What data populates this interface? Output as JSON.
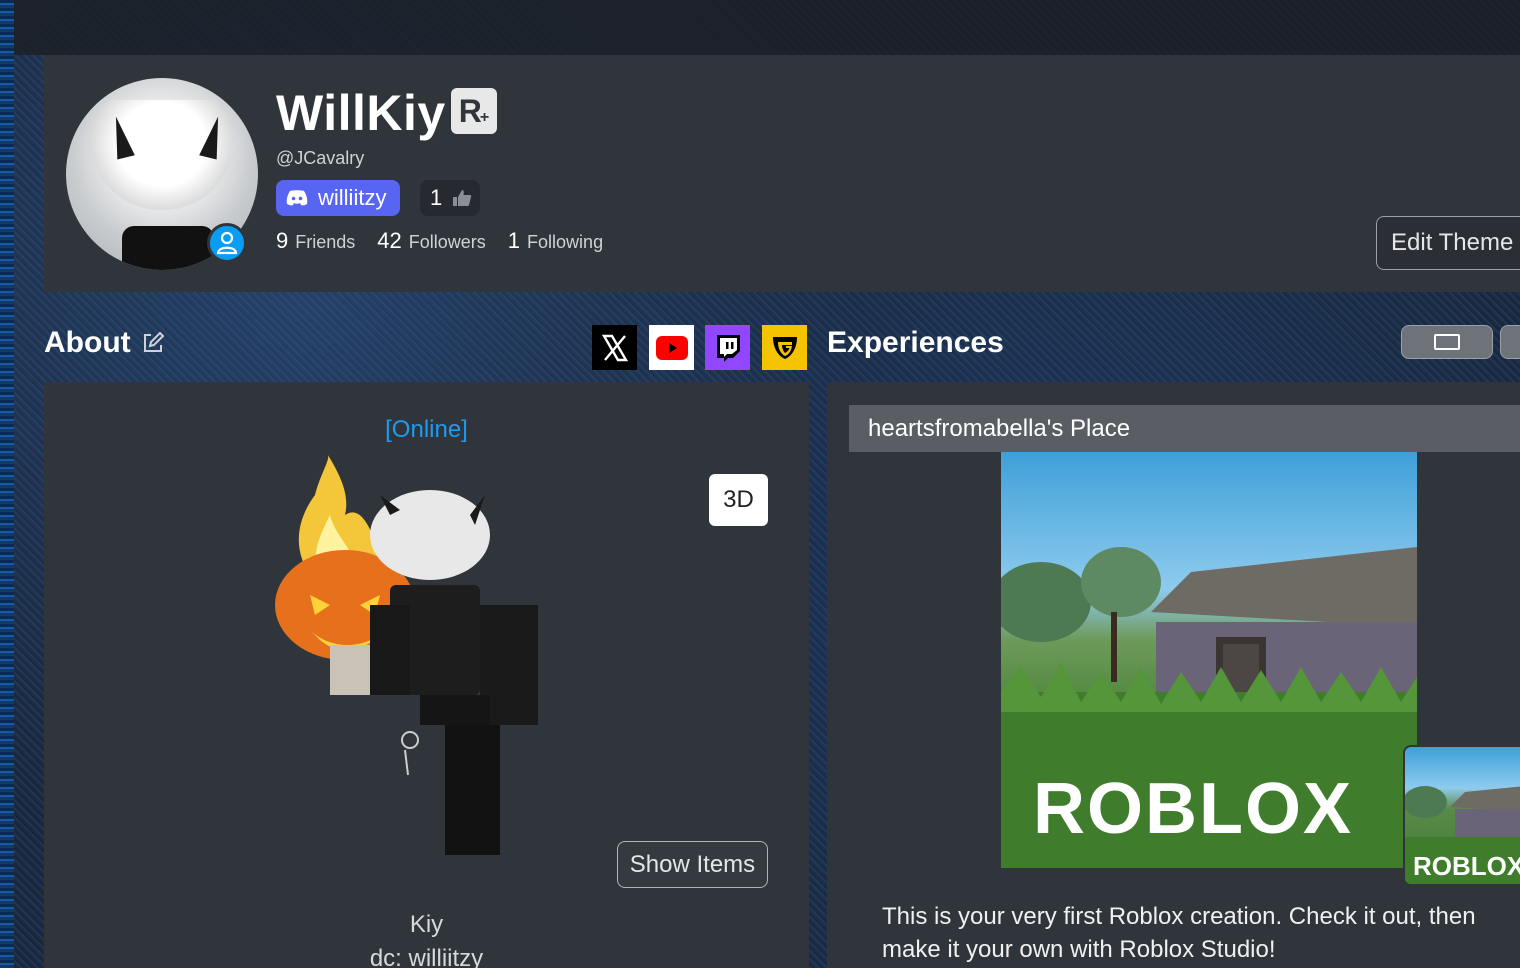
{
  "profile": {
    "display_name": "WillKiy",
    "premium_badge": "R",
    "username": "@JCavalry",
    "discord_name": "williitzy",
    "vote_count": "1",
    "stats": [
      {
        "value": "9",
        "label": "Friends"
      },
      {
        "value": "42",
        "label": "Followers"
      },
      {
        "value": "1",
        "label": "Following"
      }
    ],
    "edit_theme_label": "Edit Theme",
    "presence_color": "#0a9df4"
  },
  "about": {
    "title": "About",
    "online_status": "[Online]",
    "btn_3d": "3D",
    "show_items": "Show Items",
    "bio_line1": "Kiy",
    "bio_line2": "dc: williitzy",
    "socials": [
      {
        "name": "x-icon",
        "bg": "#000000"
      },
      {
        "name": "youtube-icon",
        "bg": "#ffffff"
      },
      {
        "name": "twitch-icon",
        "bg": "#9146ff"
      },
      {
        "name": "guilded-icon",
        "bg": "#f5c400"
      }
    ]
  },
  "experiences": {
    "title": "Experiences",
    "place_name": "heartsfromabella's Place",
    "thumbnail_logo": "ROBLOX",
    "thumbnail_logo_small": "ROBLOX",
    "description": "This is your very first Roblox creation. Check it out, then make it your own with Roblox Studio!"
  },
  "colors": {
    "accent_blue": "#1e9bf0",
    "discord": "#5865f2",
    "card": "#30353c"
  }
}
